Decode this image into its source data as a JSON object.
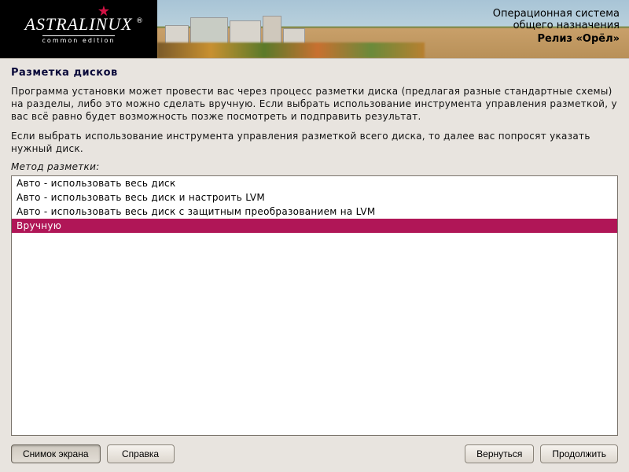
{
  "header": {
    "logo_main": "ASTRALINUX",
    "logo_sub": "common edition",
    "line1": "Операционная система",
    "line2": "общего назначения",
    "line3": "Релиз «Орёл»"
  },
  "page": {
    "title": "Разметка дисков",
    "desc1": "Программа установки может провести вас через процесс разметки диска (предлагая разные стандартные схемы) на разделы, либо это можно сделать вручную. Если выбрать использование инструмента управления разметкой, у вас всё равно будет возможность позже посмотреть и подправить результат.",
    "desc2": "Если выбрать использование инструмента управления разметкой всего диска, то далее вас попросят указать нужный диск.",
    "method_label": "Метод разметки:"
  },
  "options": [
    {
      "label": "Авто - использовать весь диск",
      "selected": false
    },
    {
      "label": "Авто - использовать весь диск и настроить LVM",
      "selected": false
    },
    {
      "label": "Авто - использовать весь диск с защитным преобразованием на LVM",
      "selected": false
    },
    {
      "label": "Вручную",
      "selected": true
    }
  ],
  "buttons": {
    "screenshot": "Снимок экрана",
    "help": "Справка",
    "back": "Вернуться",
    "continue": "Продолжить"
  }
}
